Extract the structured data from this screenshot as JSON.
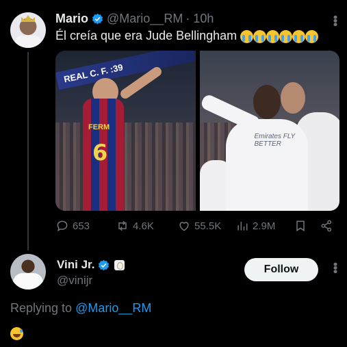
{
  "tweet": {
    "author_name": "Mario",
    "author_handle": "@Mario__RM",
    "time": "· 10h",
    "text": "Él creía que era Jude Bellingham",
    "emoji_count": 6,
    "media": {
      "left_image": "barcelona-player-photo",
      "right_image": "real-madrid-players-celebrating-photo",
      "board_text": "REAL    C. F.    :39",
      "shirt_number": "6",
      "shirt_name": "FERM",
      "sponsor_text": "Emirates FLY BETTER"
    },
    "stats": {
      "replies": "653",
      "retweets": "4.6K",
      "likes": "55.5K",
      "views": "2.9M"
    }
  },
  "reply_author": {
    "name": "Vini Jr.",
    "handle": "@vinijr",
    "follow_label": "Follow"
  },
  "replying_to": {
    "prefix": "Replying to",
    "mention": "@Mario__RM"
  },
  "colors": {
    "background": "#000000",
    "text": "#e7e9ea",
    "muted": "#71767b",
    "accent": "#1d9bf0",
    "follow_bg": "#eff3f4"
  }
}
